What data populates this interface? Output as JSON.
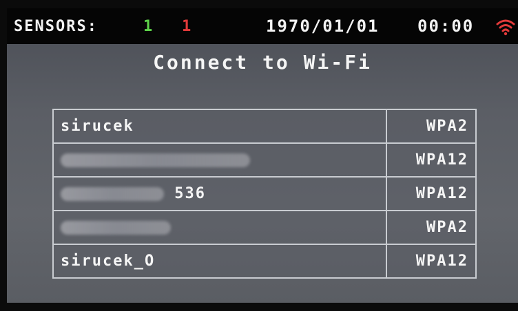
{
  "status_bar": {
    "sensors_label": "SENSORS:",
    "sensors_ok_count": "1",
    "sensors_fail_count": "1",
    "date": "1970/01/01",
    "time": "00:00",
    "wifi_icon": "wifi-icon",
    "wifi_icon_color": "#e23a3a",
    "ok_color": "#5ed44a",
    "fail_color": "#e23a3a"
  },
  "page": {
    "title": "Connect to Wi-Fi"
  },
  "networks": [
    {
      "ssid": "sirucek",
      "security": "WPA2"
    },
    {
      "ssid": "",
      "ssid_visible_fragment": "",
      "security": "WPA12"
    },
    {
      "ssid": "",
      "ssid_visible_fragment": "536",
      "security": "WPA12"
    },
    {
      "ssid": "",
      "ssid_visible_fragment": "",
      "security": "WPA2"
    },
    {
      "ssid": "sirucek_O",
      "security": "WPA12"
    }
  ]
}
